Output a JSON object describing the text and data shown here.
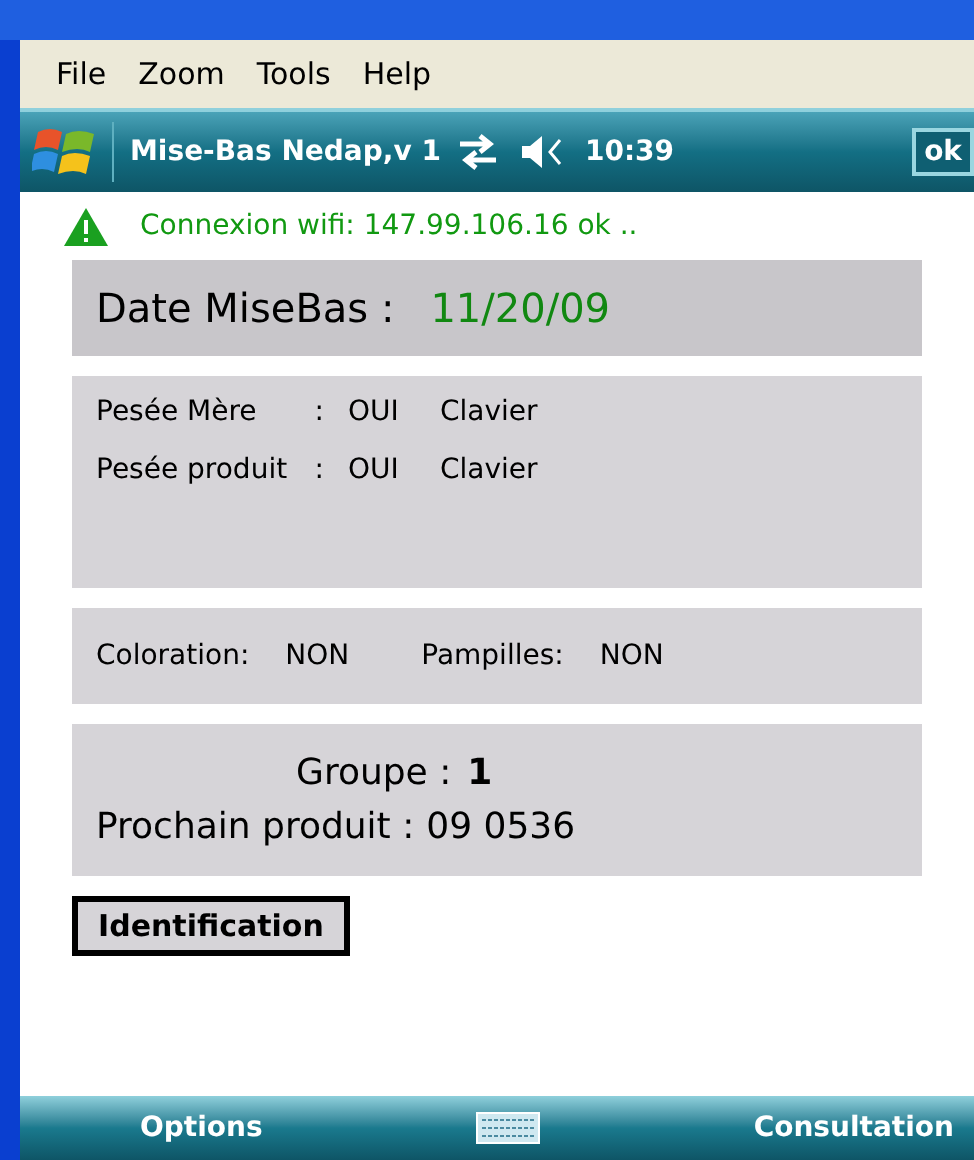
{
  "menu": [
    "File",
    "Zoom",
    "Tools",
    "Help"
  ],
  "title_bar": {
    "title": "Mise-Bas Nedap,v 1",
    "time": "10:39",
    "ok": "ok"
  },
  "status": {
    "text": "Connexion wifi: 147.99.106.16 ok .."
  },
  "date": {
    "label": "Date MiseBas :",
    "value": "11/20/09"
  },
  "weighing": [
    {
      "label": "Pesée Mère",
      "sep": ":",
      "value": "OUI",
      "mode": "Clavier"
    },
    {
      "label": "Pesée produit",
      "sep": ":",
      "value": "OUI",
      "mode": "Clavier"
    }
  ],
  "options": [
    {
      "label": "Coloration:",
      "value": "NON"
    },
    {
      "label": "Pampilles:",
      "value": "NON"
    }
  ],
  "group": {
    "label": "Groupe :",
    "value": "1"
  },
  "next": {
    "label": "Prochain produit :",
    "value": "09 0536"
  },
  "button": "Identification",
  "softkeys": [
    "Options",
    "Consultation"
  ]
}
